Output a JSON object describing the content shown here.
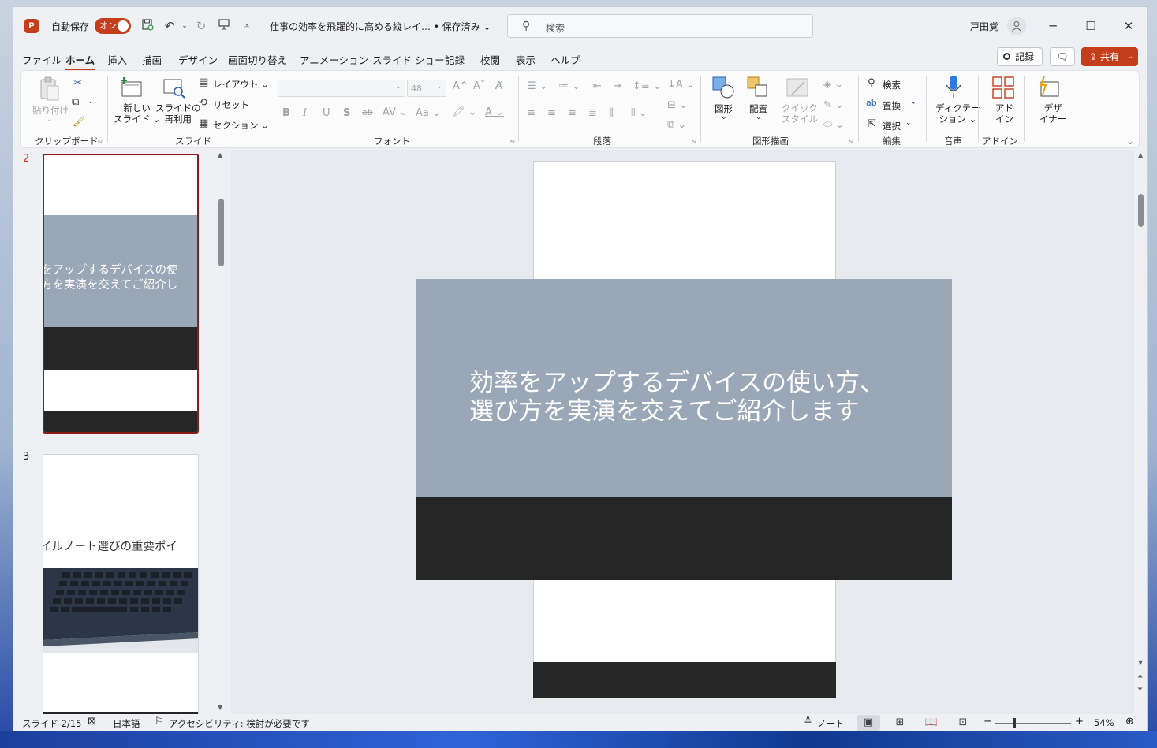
{
  "titlebar": {
    "logo": "P",
    "autosave_label": "自動保存",
    "autosave_state": "オン",
    "doc_title": "仕事の効率を飛躍的に高める縦レイ… • 保存済み ⌄",
    "search_placeholder": "検索",
    "user_name": "戸田覚",
    "icons": [
      "save-sync-icon",
      "undo-icon",
      "redo-icon",
      "present-icon",
      "customize-qat-icon"
    ]
  },
  "menu": {
    "tabs": [
      "ファイル",
      "ホーム",
      "挿入",
      "描画",
      "デザイン",
      "画面切り替え",
      "アニメーション",
      "スライド ショー",
      "記録",
      "校閲",
      "表示",
      "ヘルプ"
    ],
    "active_tab": "ホーム",
    "record_label": "記録",
    "share_label": "共有"
  },
  "ribbon": {
    "clipboard": {
      "paste": "貼り付け",
      "label": "クリップボード"
    },
    "slides": {
      "new_slide": "新しい\nスライド ⌄",
      "reuse": "スライドの\n再利用",
      "layout": "レイアウト ⌄",
      "reset": "リセット",
      "section": "セクション ⌄",
      "label": "スライド"
    },
    "font": {
      "size": "48",
      "label": "フォント",
      "bold": "B",
      "italic": "I",
      "underline": "U",
      "shadow": "S",
      "strike": "ab"
    },
    "paragraph": {
      "label": "段落"
    },
    "drawing": {
      "shapes": "図形",
      "arrange": "配置",
      "quick_styles": "クイック\nスタイル",
      "label": "図形描画"
    },
    "editing": {
      "find": "検索",
      "replace": "置換",
      "select": "選択",
      "label": "編集"
    },
    "voice": {
      "dictate": "ディクテー\nション ⌄",
      "label": "音声"
    },
    "addins": {
      "addins": "アド\nイン",
      "label": "アドイン"
    },
    "designer": {
      "designer": "デザ\nイナー"
    }
  },
  "thumbnails": [
    {
      "number": "2",
      "text_line1": "をアップするデバイスの使",
      "text_line2": "方を実演を交えてご紹介し"
    },
    {
      "number": "3",
      "text_line1": "イルノート選びの重要ポイ"
    }
  ],
  "slide": {
    "title_line1": "効率をアップするデバイスの使い方、",
    "title_line2": "選び方を実演を交えてご紹介します"
  },
  "statusbar": {
    "slide_pos": "スライド 2/15",
    "language": "日本語",
    "accessibility": "アクセシビリティ: 検討が必要です",
    "notes": "ノート",
    "zoom": "54%"
  },
  "colors": {
    "accent": "#c43e1c",
    "slide_gray": "#9aa7b6",
    "slide_dark": "#262626"
  }
}
